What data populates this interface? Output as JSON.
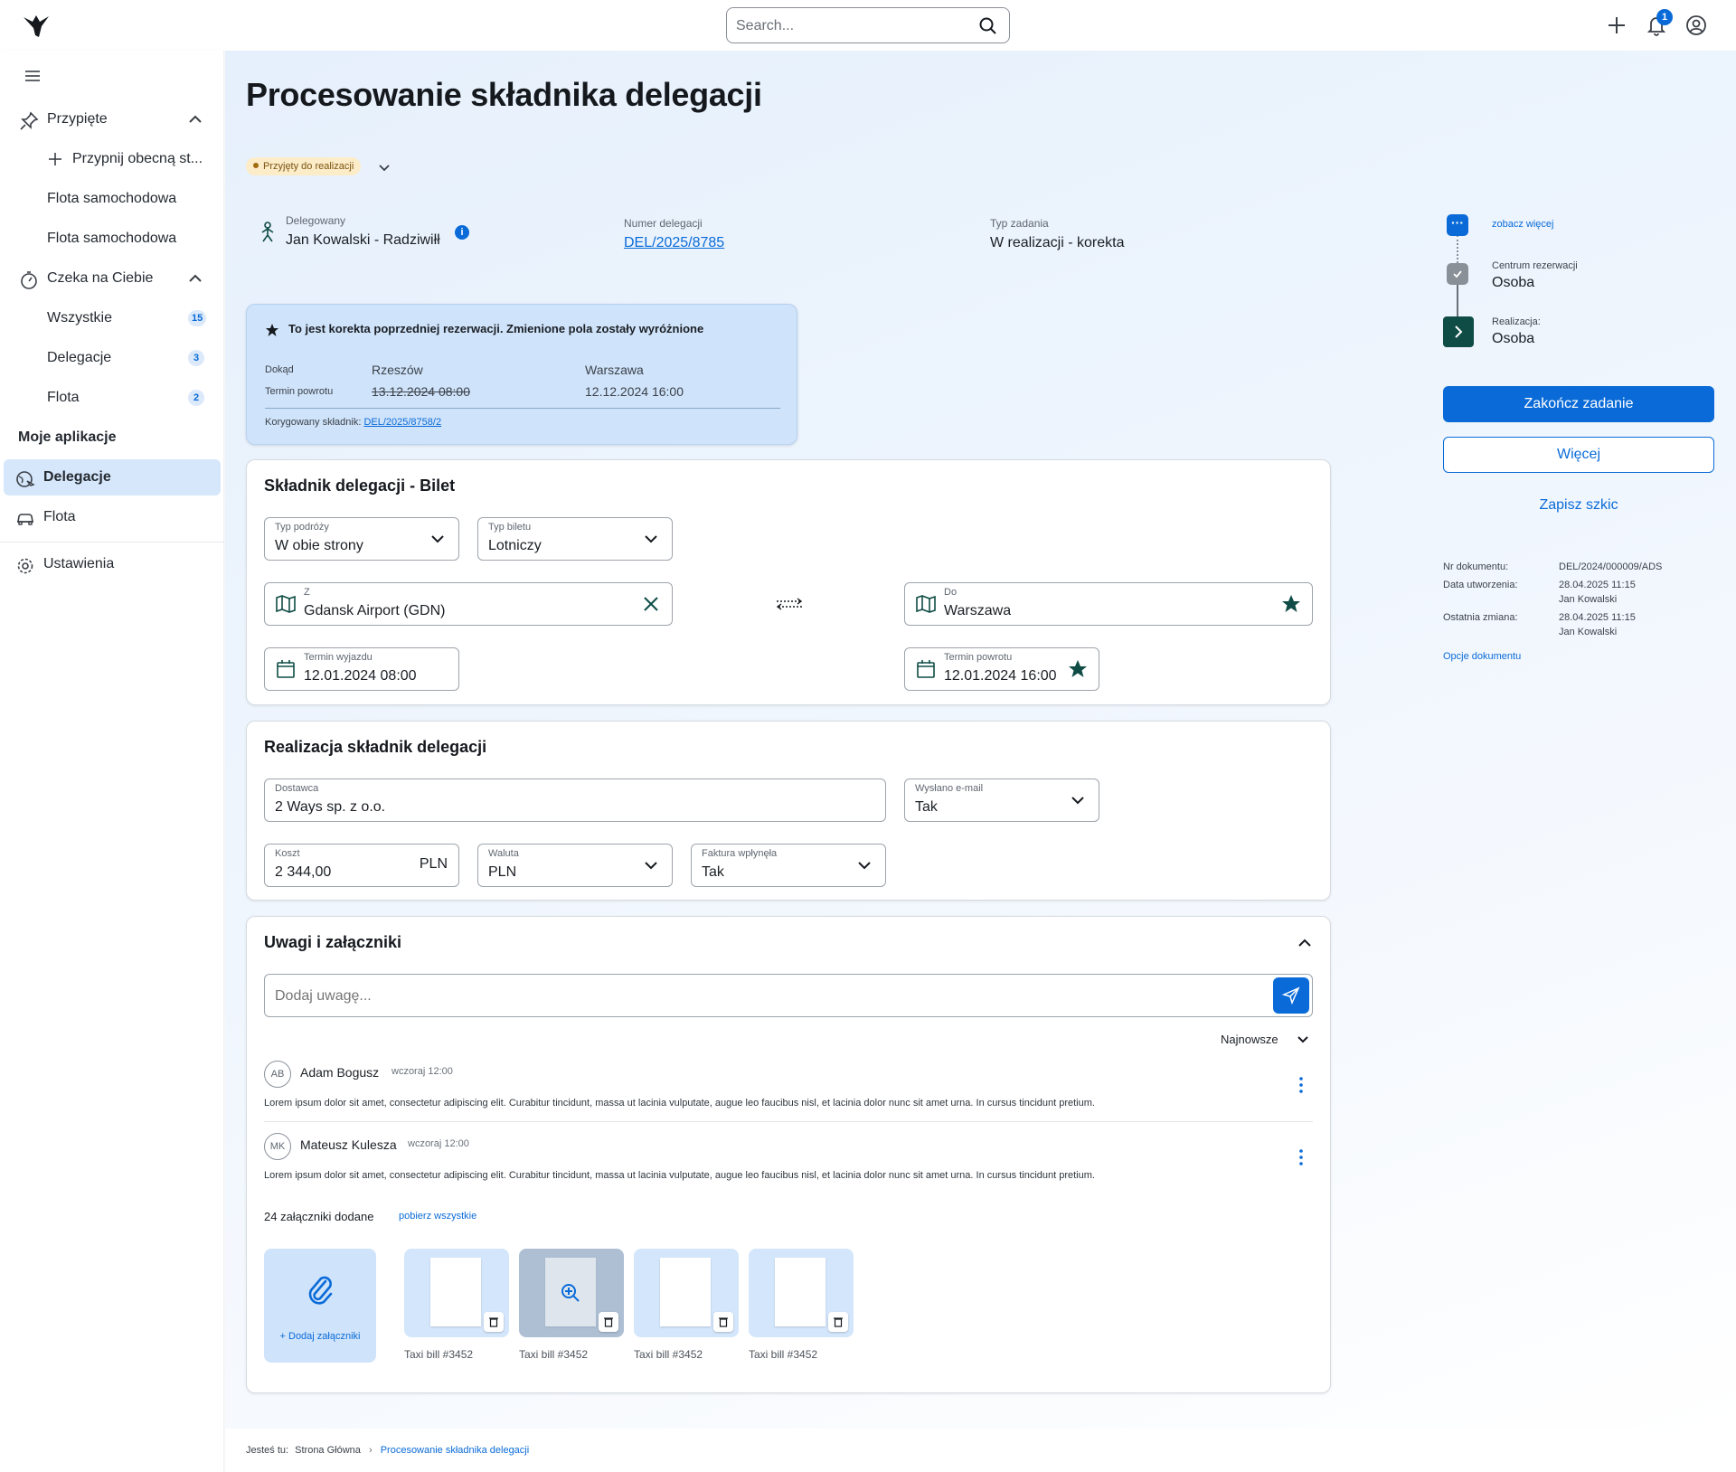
{
  "topbar": {
    "search_placeholder": "Search...",
    "notification_count": "1"
  },
  "sidebar": {
    "pinned": {
      "label": "Przypięte",
      "pin_current": "Przypnij obecną st...",
      "items": [
        "Flota samochodowa",
        "Flota samochodowa"
      ]
    },
    "waiting": {
      "label": "Czeka na Ciebie",
      "items": [
        {
          "label": "Wszystkie",
          "count": "15"
        },
        {
          "label": "Delegacje",
          "count": "3"
        },
        {
          "label": "Flota",
          "count": "2"
        }
      ]
    },
    "my_apps": {
      "label": "Moje aplikacje",
      "items": [
        "Delegacje",
        "Flota"
      ]
    },
    "settings": "Ustawienia"
  },
  "page": {
    "title": "Procesowanie składnika delegacji",
    "status": "Przyjęty do realizacji",
    "delegate_label": "Delegowany",
    "delegate_value": "Jan Kowalski - Radziwiłł",
    "number_label": "Numer delegacji",
    "number_value": "DEL/2025/8785",
    "task_type_label": "Typ zadania",
    "task_type_value": "W realizacji - korekta"
  },
  "correction": {
    "heading": "To jest korekta poprzedniej rezerwacji. Zmienione pola zostały wyróżnione",
    "row1_label": "Dokąd",
    "row1_old": "Rzeszów",
    "row1_new": "Warszawa",
    "row2_label": "Termin powrotu",
    "row2_old": "13.12.2024 08:00",
    "row2_new": "12.12.2024 16:00",
    "corrected_label": "Korygowany składnik:",
    "corrected_value": "DEL/2025/8758/2"
  },
  "ticket": {
    "title": "Składnik delegacji - Bilet",
    "trip_type_label": "Typ podróży",
    "trip_type_value": "W obie strony",
    "ticket_type_label": "Typ biletu",
    "ticket_type_value": "Lotniczy",
    "from_label": "Z",
    "from_value": "Gdansk Airport (GDN)",
    "to_label": "Do",
    "to_value": "Warszawa",
    "depart_label": "Termin wyjazdu",
    "depart_value": "12.01.2024 08:00",
    "return_label": "Termin powrotu",
    "return_value": "12.01.2024 16:00"
  },
  "realization": {
    "title": "Realizacja składnik delegacji",
    "supplier_label": "Dostawca",
    "supplier_value": "2 Ways sp. z o.o.",
    "email_label": "Wysłano e-mail",
    "email_value": "Tak",
    "cost_label": "Koszt",
    "cost_value": "2 344,00",
    "cost_unit": "PLN",
    "currency_label": "Waluta",
    "currency_value": "PLN",
    "invoice_label": "Faktura wpłynęła",
    "invoice_value": "Tak"
  },
  "notes": {
    "title": "Uwagi  i załączniki",
    "input_placeholder": "Dodaj uwagę...",
    "sort_label": "Najnowsze",
    "comments": [
      {
        "initials": "AB",
        "author": "Adam Bogusz",
        "time": "wczoraj 12:00",
        "text": "Lorem ipsum dolor sit amet, consectetur adipiscing elit. Curabitur tincidunt, massa ut lacinia vulputate, augue leo faucibus nisl, et lacinia dolor nunc sit amet urna. In cursus tincidunt pretium."
      },
      {
        "initials": "MK",
        "author": "Mateusz Kulesza",
        "time": "wczoraj 12:00",
        "text": "Lorem ipsum dolor sit amet, consectetur adipiscing elit. Curabitur tincidunt, massa ut lacinia vulputate, augue leo faucibus nisl, et lacinia dolor nunc sit amet urna. In cursus tincidunt pretium."
      }
    ],
    "attachments_count_label": "24 załączniki dodane",
    "download_all": "pobierz wszystkie",
    "add_attachments": "+ Dodaj załączniki",
    "attachments": [
      "Taxi bill #3452",
      "Taxi bill #3452",
      "Taxi bill #3452",
      "Taxi bill #3452"
    ]
  },
  "workflow": {
    "see_more": "zobacz więcej",
    "step1_label": "Centrum rezerwacji",
    "step1_value": "Osoba",
    "step2_label": "Realizacja:",
    "step2_value": "Osoba"
  },
  "actions": {
    "finish": "Zakończ zadanie",
    "more": "Więcej",
    "save_draft": "Zapisz szkic"
  },
  "document": {
    "nr_label": "Nr dokumentu:",
    "nr_value": "DEL/2024/000009/ADS",
    "created_label": "Data utworzenia:",
    "created_value": "28.04.2025 11:15",
    "created_by": "Jan Kowalski",
    "changed_label": "Ostatnia zmiana:",
    "changed_value": "28.04.2025 11:15",
    "changed_by": "Jan Kowalski",
    "options": "Opcje dokumentu"
  },
  "breadcrumb": {
    "prefix": "Jesteś tu:",
    "home": "Strona Główna",
    "current": "Procesowanie składnika delegacji"
  },
  "colors": {
    "accent": "#0a6bd8",
    "dark_green": "#0f4c45",
    "status_bg": "#fdecc8"
  }
}
